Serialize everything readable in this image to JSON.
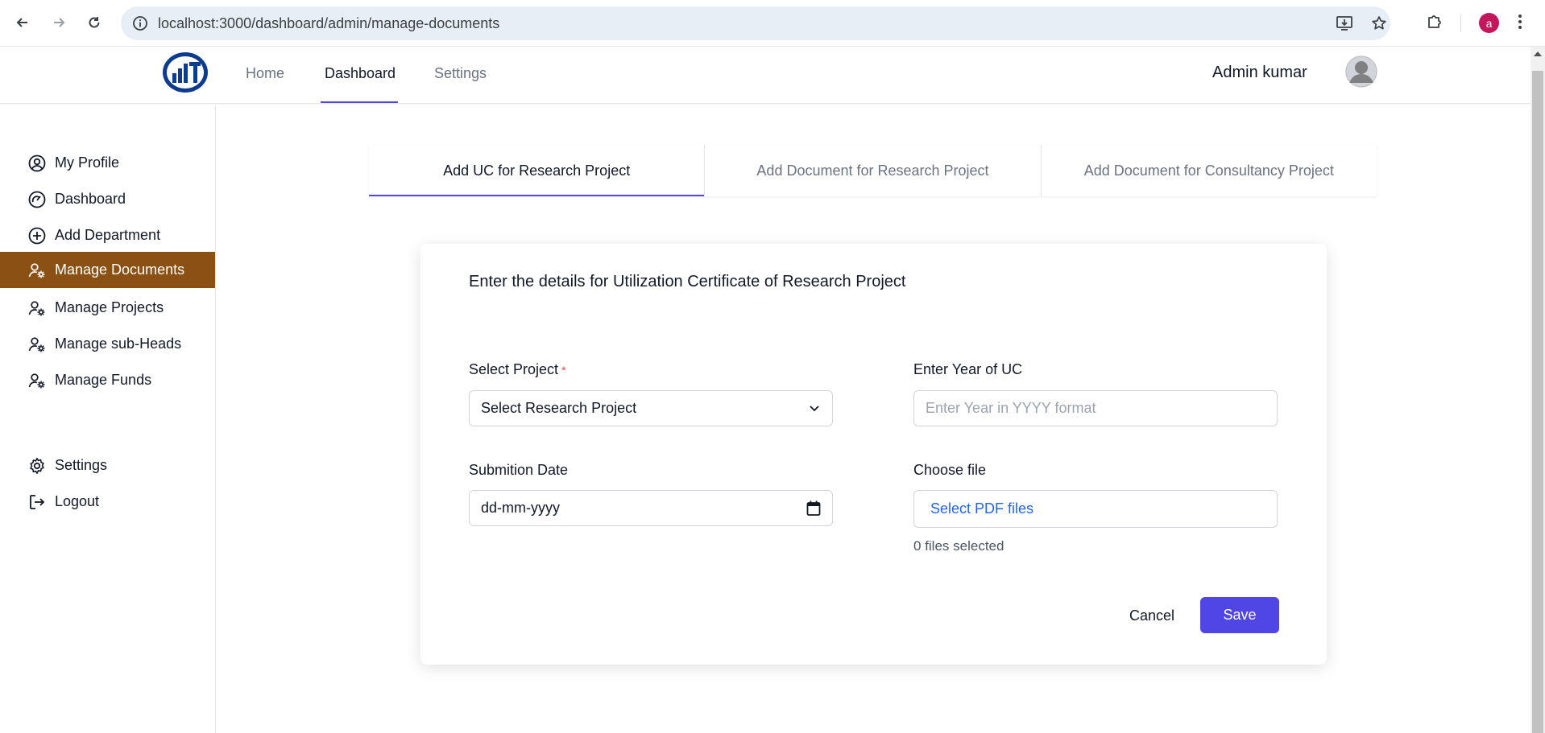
{
  "browser": {
    "url": "localhost:3000/dashboard/admin/manage-documents",
    "profile_initial": "a"
  },
  "header": {
    "nav": [
      {
        "label": "Home"
      },
      {
        "label": "Dashboard",
        "active": true
      },
      {
        "label": "Settings"
      }
    ],
    "user_name": "Admin kumar"
  },
  "sidebar": {
    "items": [
      {
        "label": "My Profile",
        "icon": "user-circle-icon"
      },
      {
        "label": "Dashboard",
        "icon": "gauge-icon"
      },
      {
        "label": "Add Department",
        "icon": "plus-circle-icon"
      },
      {
        "label": "Manage Documents",
        "icon": "user-gear-icon",
        "active": true
      },
      {
        "label": "Manage Projects",
        "icon": "user-gear-icon"
      },
      {
        "label": "Manage sub-Heads",
        "icon": "user-gear-icon"
      },
      {
        "label": "Manage Funds",
        "icon": "user-gear-icon"
      },
      {
        "label": "Settings",
        "icon": "gear-icon"
      },
      {
        "label": "Logout",
        "icon": "logout-icon"
      }
    ]
  },
  "tabs": [
    {
      "label": "Add UC for Research Project",
      "active": true
    },
    {
      "label": "Add Document for Research Project"
    },
    {
      "label": "Add Document for Consultancy Project"
    }
  ],
  "form": {
    "title": "Enter the details for Utilization Certificate of Research Project",
    "project_label": "Select Project",
    "project_required_mark": "*",
    "project_value": "Select Research Project",
    "year_label": "Enter Year of UC",
    "year_placeholder": "Enter Year in YYYY format",
    "date_label": "Submition Date",
    "date_value": "dd-mm-yyyy",
    "file_label": "Choose file",
    "file_button": "Select PDF files",
    "files_selected": "0 files selected",
    "cancel_label": "Cancel",
    "save_label": "Save"
  },
  "colors": {
    "accent": "#4f46e5",
    "sidebar_active": "#8b5014"
  }
}
